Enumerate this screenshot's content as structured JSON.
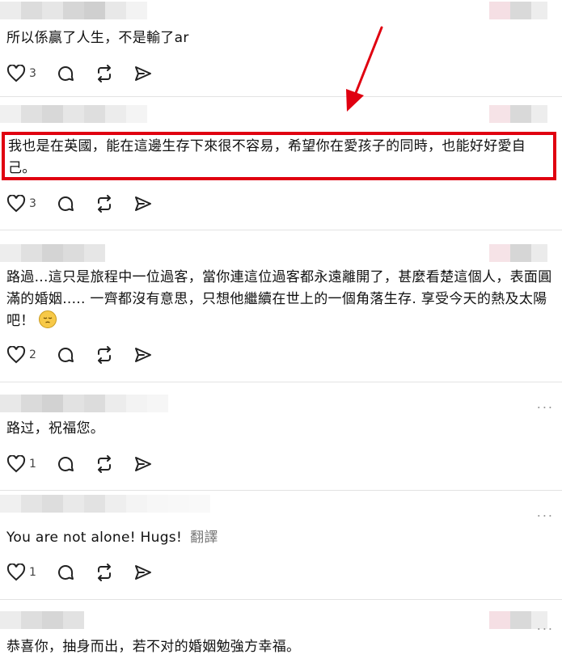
{
  "comments": [
    {
      "text": "所以係贏了人生，不是輸了ar",
      "likes": "3"
    },
    {
      "text": "我也是在英國，能在這邊生存下來很不容易，希望你在愛孩子的同時，也能好好愛自己。",
      "likes": "3"
    },
    {
      "text_a": "路過...這只是旅程中一位過客，當你連這位過客都永遠離開了，甚麼看楚這個人，表面圓滿的婚姻..... 一齊都沒有意思，只想他繼續在世上的一個角落生存. 享受今天的熱及太陽吧！",
      "likes": "2"
    },
    {
      "text": "路过，祝福您。",
      "likes": "1"
    },
    {
      "text": "You are not alone! Hugs!",
      "translate": "翻譯",
      "likes": "1"
    },
    {
      "text": "恭喜你，抽身而出，若不对的婚姻勉強方幸福。"
    }
  ],
  "more_icon": "...",
  "colors": {
    "highlight": "#e00010",
    "arrow": "#e00010"
  }
}
